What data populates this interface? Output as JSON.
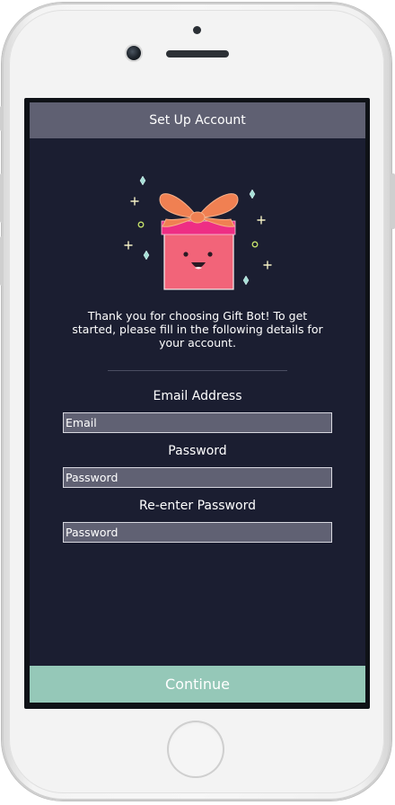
{
  "header": {
    "title": "Set Up Account"
  },
  "illustration": {
    "icon": "gift-box-smiling-icon",
    "colors": {
      "box": "#f26479",
      "lid": "#ee2e84",
      "ribbon": "#f08052",
      "sparkle_diamond": "#a7dfd7",
      "sparkle_plus": "#f3efc4",
      "sparkle_circle": "#c7e36b"
    }
  },
  "intro": {
    "text": "Thank you for choosing Gift Bot! To get started, please fill in the following details for your account."
  },
  "form": {
    "email_label": "Email Address",
    "email_placeholder": "Email",
    "password_label": "Password",
    "password_placeholder": "Password",
    "confirm_label": "Re-enter Password",
    "confirm_placeholder": "Password"
  },
  "footer": {
    "continue_label": "Continue"
  },
  "theme": {
    "background": "#1b1e31",
    "header_bg": "#5f6072",
    "input_bg": "#606173",
    "accent": "#95c8b8"
  }
}
